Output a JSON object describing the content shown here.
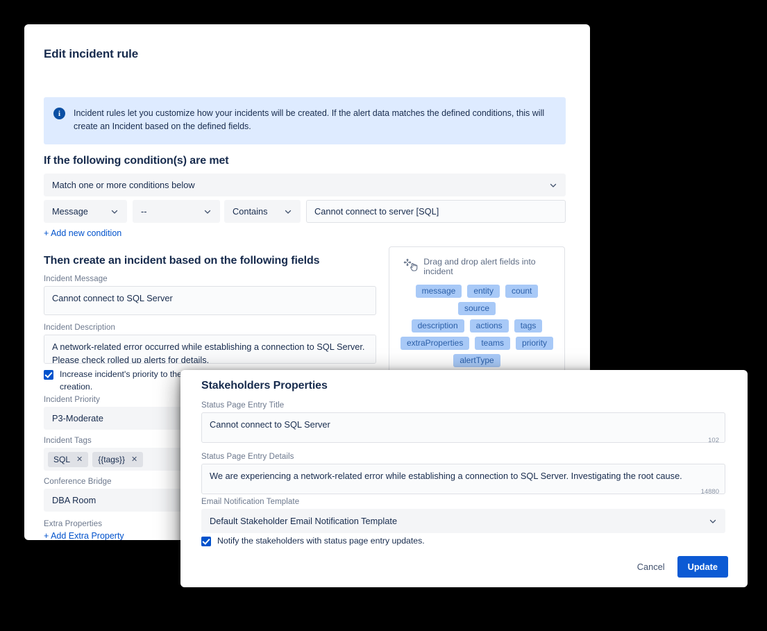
{
  "rule_card": {
    "title": "Edit incident rule",
    "info_banner": {
      "icon": "info-icon",
      "text": "Incident rules let you customize how your incidents will be created. If the alert data matches the defined conditions, this will create an Incident based on the defined fields."
    },
    "conditions_section": {
      "heading": "If the following condition(s) are met",
      "match_select": "Match one or more conditions below",
      "condition_row": {
        "field": "Message",
        "key": "--",
        "operator": "Contains",
        "value": "Cannot connect to server [SQL]"
      },
      "add_condition_link": "+ Add new condition"
    },
    "fields_section": {
      "heading": "Then create an incident based on the following fields",
      "incident_message_label": "Incident Message",
      "incident_message_value": "Cannot connect to SQL Server",
      "incident_description_label": "Incident Description",
      "incident_description_value": "A network-related error occurred while establishing a connection to SQL Server. Please check rolled up alerts for details.",
      "increase_priority_checkbox": "Increase incident's priority to the highest priority of the alerts associated after incident creation.",
      "incident_priority_label": "Incident Priority",
      "incident_priority_value": "P3-Moderate",
      "incident_tags_label": "Incident Tags",
      "incident_tags": [
        "SQL",
        "{{tags}}"
      ],
      "conference_bridge_label": "Conference Bridge",
      "conference_bridge_value": "DBA Room",
      "extra_properties_label": "Extra Properties",
      "add_extra_property_link": "+ Add Extra Property"
    },
    "drag_panel": {
      "header": "Drag and drop alert fields into incident",
      "chips_row_1": [
        "message",
        "entity",
        "count",
        "source"
      ],
      "chips_row_2": [
        "description",
        "actions",
        "tags"
      ],
      "chips_row_3": [
        "extraProperties",
        "teams",
        "priority"
      ],
      "chips_row_4": [
        "alertType"
      ]
    }
  },
  "stakeholders_modal": {
    "title": "Stakeholders Properties",
    "status_page_entry_title_label": "Status Page Entry Title",
    "status_page_entry_title_value": "Cannot connect to SQL Server",
    "status_page_entry_title_counter": "102",
    "status_page_entry_details_label": "Status Page Entry Details",
    "status_page_entry_details_value": "We are experiencing a network-related error while establishing a connection to SQL Server. Investigating the root cause.",
    "status_page_entry_details_counter": "14880",
    "email_template_label": "Email Notification Template",
    "email_template_value": "Default Stakeholder Email Notification Template",
    "notify_checkbox": "Notify the stakeholders with status page entry updates.",
    "cancel_label": "Cancel",
    "update_label": "Update"
  },
  "colors": {
    "brand_blue": "#0052cc",
    "primary_button": "#0c5ad4",
    "banner_bg": "#deebff",
    "chip_bg": "#a8c9f7",
    "text": "#172b4d",
    "muted_text": "#6b778c",
    "field_bg": "#f4f5f7"
  }
}
